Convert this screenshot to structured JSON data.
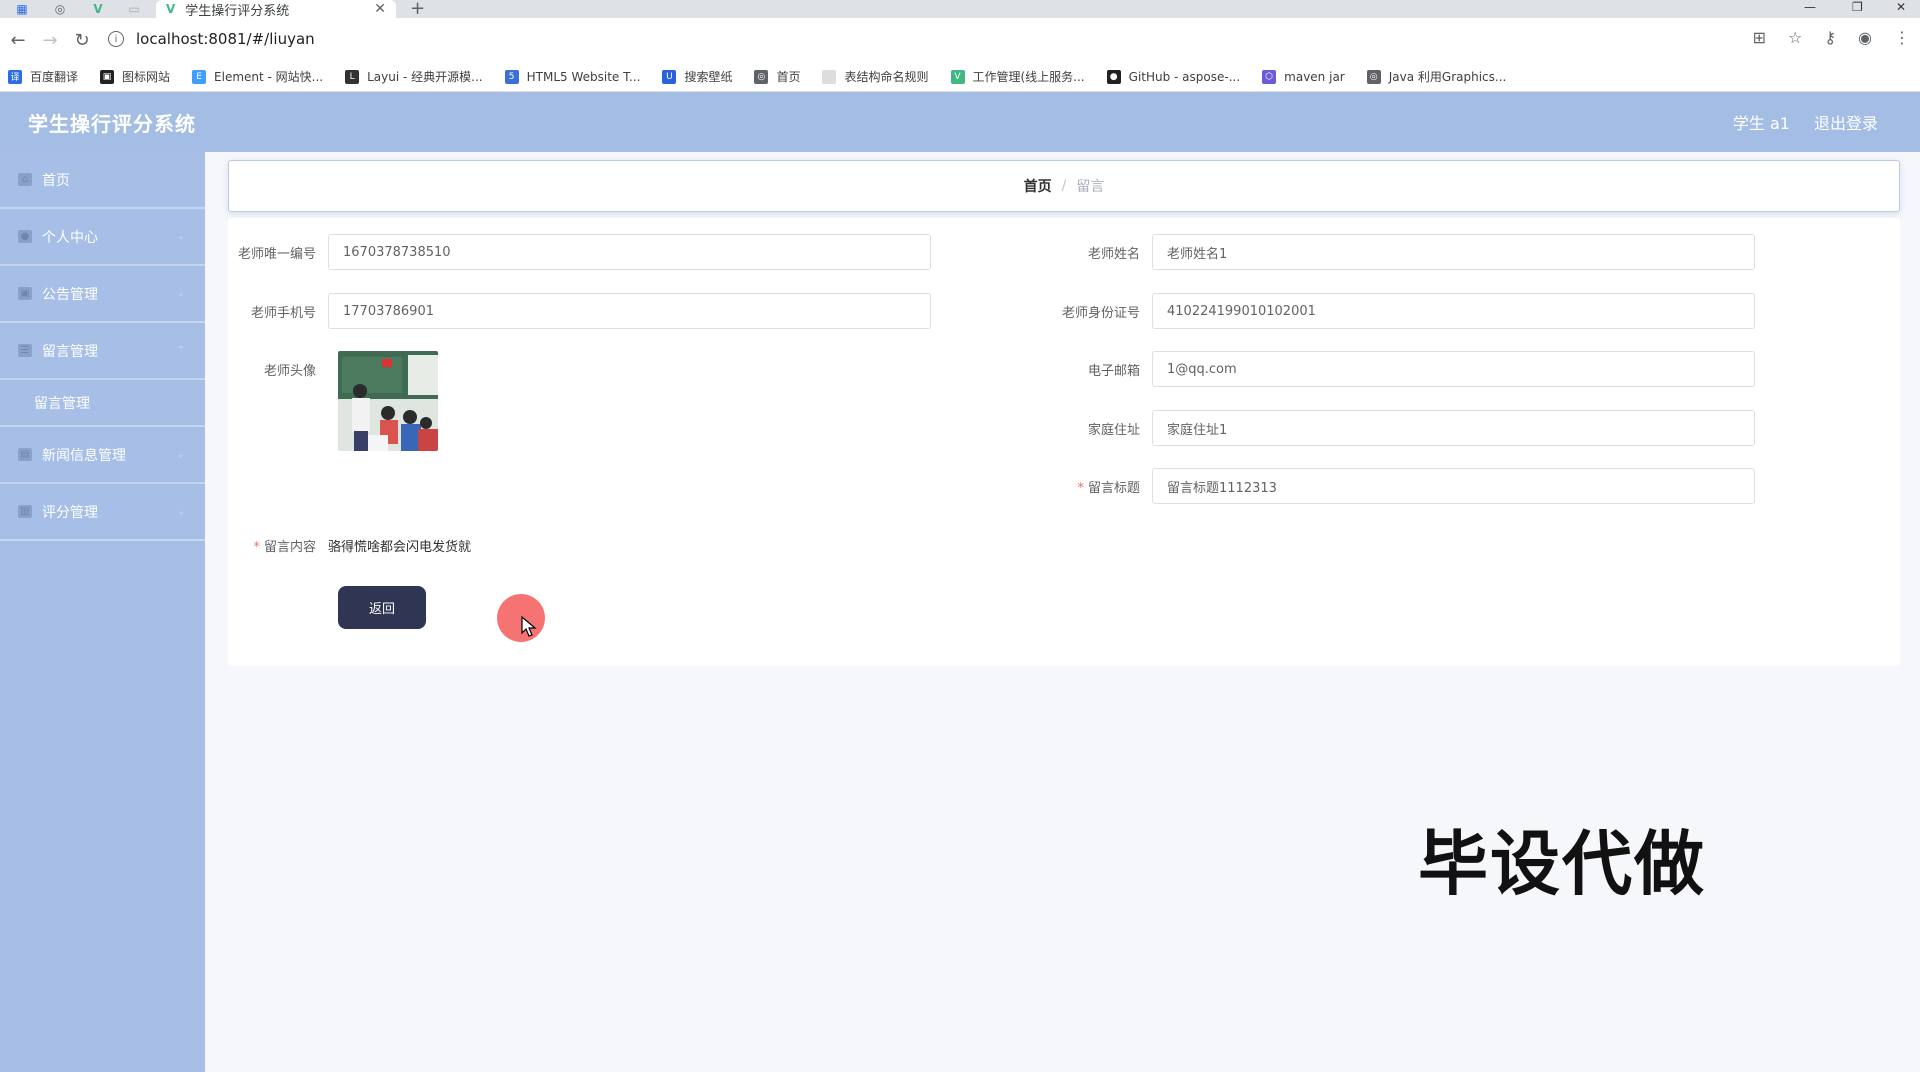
{
  "browser": {
    "tab_title": "学生操行评分系统",
    "url": "localhost:8081/#/liuyan",
    "bookmarks": [
      {
        "label": "百度翻译",
        "icon": "baidu-translate-icon",
        "color": "#2b6de5"
      },
      {
        "label": "图标网站",
        "icon": "iconfont-icon",
        "color": "#222222"
      },
      {
        "label": "Element - 网站快...",
        "icon": "element-icon",
        "color": "#409eff"
      },
      {
        "label": "Layui - 经典开源模...",
        "icon": "layui-icon",
        "color": "#333333"
      },
      {
        "label": "HTML5 Website T...",
        "icon": "html5-icon",
        "color": "#3b6fd6"
      },
      {
        "label": "搜索壁纸",
        "icon": "wallpaper-icon",
        "color": "#2962d9"
      },
      {
        "label": "首页",
        "icon": "globe-icon",
        "color": "#5f6368"
      },
      {
        "label": "表结构命名规则",
        "icon": "page-icon",
        "color": "#dddddd"
      },
      {
        "label": "工作管理(线上服务...",
        "icon": "vue-icon",
        "color": "#41b883"
      },
      {
        "label": "GitHub - aspose-...",
        "icon": "github-icon",
        "color": "#222222"
      },
      {
        "label": "maven jar",
        "icon": "maven-icon",
        "color": "#6b5bd6"
      },
      {
        "label": "Java 利用Graphics...",
        "icon": "globe-icon",
        "color": "#5f6368"
      }
    ]
  },
  "header": {
    "title": "学生操行评分系统",
    "user": "学生 a1",
    "logout": "退出登录"
  },
  "sidebar": {
    "items": [
      {
        "label": "首页",
        "icon": "home-icon"
      },
      {
        "label": "个人中心",
        "icon": "user-icon"
      },
      {
        "label": "公告管理",
        "icon": "notice-icon"
      },
      {
        "label": "留言管理",
        "icon": "list-icon"
      },
      {
        "label": "新闻信息管理",
        "icon": "news-icon"
      },
      {
        "label": "评分管理",
        "icon": "score-icon"
      }
    ],
    "submenu": {
      "label": "留言管理"
    }
  },
  "breadcrumb": {
    "home": "首页",
    "separator": "/",
    "current": "留言"
  },
  "form": {
    "teacher_id": {
      "label": "老师唯一编号",
      "value": "1670378738510"
    },
    "teacher_name": {
      "label": "老师姓名",
      "value": "老师姓名1"
    },
    "teacher_phone": {
      "label": "老师手机号",
      "value": "17703786901"
    },
    "teacher_idcard": {
      "label": "老师身份证号",
      "value": "410224199010102001"
    },
    "teacher_avatar": {
      "label": "老师头像"
    },
    "email": {
      "label": "电子邮箱",
      "value": "1@qq.com"
    },
    "address": {
      "label": "家庭住址",
      "value": "家庭住址1"
    },
    "message_title": {
      "label": "留言标题",
      "value": "留言标题1112313"
    },
    "message_content": {
      "label": "留言内容",
      "value": "骆得慌啥都会闪电发货就"
    },
    "back_button": "返回"
  },
  "overlay": {
    "watermark": "毕设代做"
  }
}
